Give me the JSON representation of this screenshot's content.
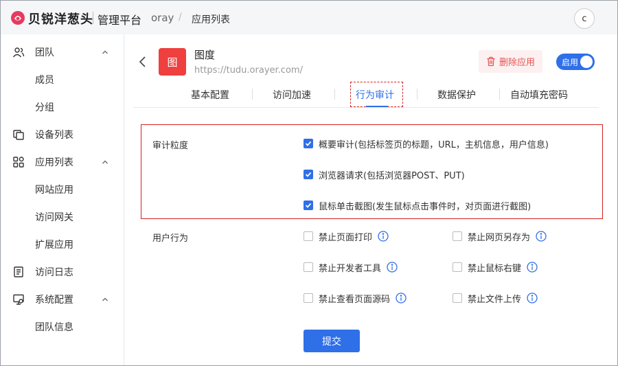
{
  "header": {
    "brand": "贝锐洋葱头",
    "brand_sub": "管理平台",
    "breadcrumb": [
      "oray",
      "应用列表"
    ],
    "avatar": "c"
  },
  "sidebar": {
    "items": [
      {
        "label": "团队",
        "icon": "team-icon",
        "expanded": true
      },
      {
        "label": "成员"
      },
      {
        "label": "分组"
      },
      {
        "label": "设备列表",
        "icon": "device-icon"
      },
      {
        "label": "应用列表",
        "icon": "app-grid-icon",
        "expanded": true
      },
      {
        "label": "网站应用"
      },
      {
        "label": "访问网关"
      },
      {
        "label": "扩展应用"
      },
      {
        "label": "访问日志",
        "icon": "log-icon"
      },
      {
        "label": "系统配置",
        "icon": "settings-monitor-icon",
        "expanded": true
      },
      {
        "label": "团队信息"
      }
    ]
  },
  "app": {
    "icon_text": "图",
    "name": "图度",
    "url": "https://tudu.orayer.com/",
    "delete_label": "删除应用",
    "toggle_label": "启用",
    "enabled": true
  },
  "tabs": [
    "基本配置",
    "访问加速",
    "行为审计",
    "数据保护",
    "自动填充密码"
  ],
  "active_tab": "行为审计",
  "audit": {
    "label": "审计粒度",
    "options": [
      {
        "label": "概要审计(包括标签页的标题，URL，主机信息，用户信息)",
        "checked": true
      },
      {
        "label": "浏览器请求(包括浏览器POST、PUT)",
        "checked": true
      },
      {
        "label": "鼠标单击截图(发生鼠标点击事件时，对页面进行截图)",
        "checked": true
      }
    ]
  },
  "user_behavior": {
    "label": "用户行为",
    "options": [
      {
        "label": "禁止页面打印",
        "checked": false
      },
      {
        "label": "禁止网页另存为",
        "checked": false
      },
      {
        "label": "禁止开发者工具",
        "checked": false
      },
      {
        "label": "禁止鼠标右键",
        "checked": false
      },
      {
        "label": "禁止查看页面源码",
        "checked": false
      },
      {
        "label": "禁止文件上传",
        "checked": false
      }
    ]
  },
  "submit_label": "提交",
  "colors": {
    "accent": "#2f6fe8",
    "danger": "#e35555",
    "app_icon": "#ef3f3f"
  }
}
